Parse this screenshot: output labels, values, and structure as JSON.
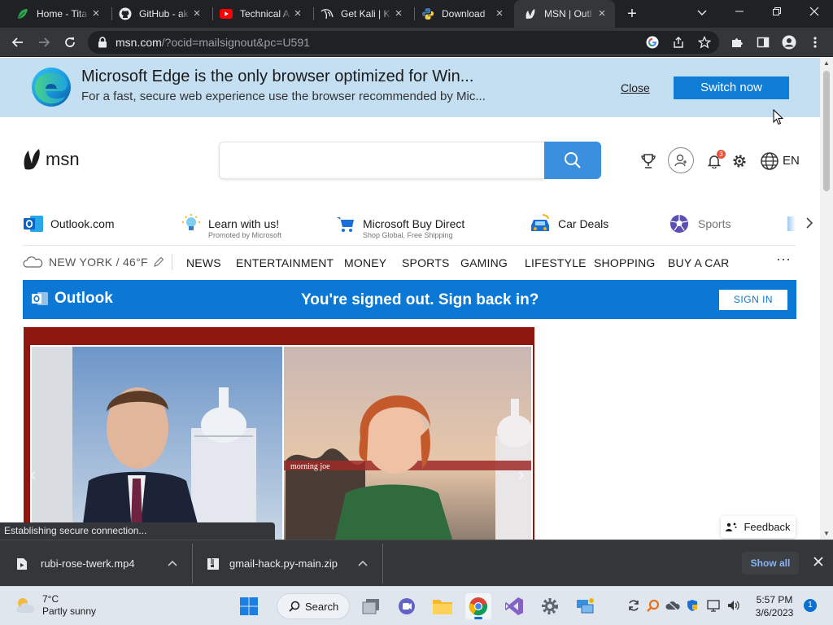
{
  "browser": {
    "tabs": [
      {
        "title": "Home - Tita",
        "favicon": "leaf-icon"
      },
      {
        "title": "GitHub - ak",
        "favicon": "github-icon"
      },
      {
        "title": "Technical A",
        "favicon": "youtube-icon"
      },
      {
        "title": "Get Kali | K",
        "favicon": "kali-dragon-icon"
      },
      {
        "title": "Download",
        "favicon": "python-icon"
      },
      {
        "title": "MSN | Outl",
        "favicon": "msn-butterfly-icon",
        "active": true
      }
    ],
    "url_host": "msn.com",
    "url_rest": "/?ocid=mailsignout&pc=U591"
  },
  "edge_banner": {
    "title": "Microsoft Edge is the only browser optimized for Win...",
    "subtitle": "For a fast, secure web experience use the browser recommended by Mic...",
    "close_label": "Close",
    "switch_label": "Switch now"
  },
  "msn": {
    "logo_text": "msn",
    "search_placeholder": "",
    "notification_count": "3",
    "language": "EN"
  },
  "quick_links": [
    {
      "label": "Outlook.com",
      "sub": ""
    },
    {
      "label": "Learn with us!",
      "sub": "Promoted by Microsoft"
    },
    {
      "label": "Microsoft Buy Direct",
      "sub": "Shop Global, Free Shipping"
    },
    {
      "label": "Car Deals",
      "sub": ""
    },
    {
      "label": "Sports",
      "sub": ""
    }
  ],
  "nav": {
    "weather": "NEW YORK / 46°F",
    "items": [
      "NEWS",
      "ENTERTAINMENT",
      "MONEY",
      "SPORTS",
      "GAMING",
      "LIFESTYLE",
      "SHOPPING",
      "BUY A CAR"
    ],
    "more": "···"
  },
  "outlook_banner": {
    "brand": "Outlook",
    "message": "You're signed out. Sign back in?",
    "signin_label": "SIGN IN"
  },
  "hero": {
    "caption_text": "morning joe"
  },
  "feedback_label": "Feedback",
  "status_text": "Establishing secure connection...",
  "downloads": {
    "items": [
      {
        "name": "rubi-rose-twerk.mp4"
      },
      {
        "name": "gmail-hack.py-main.zip"
      }
    ],
    "show_all": "Show all"
  },
  "taskbar": {
    "weather_temp": "7°C",
    "weather_cond": "Partly sunny",
    "search_label": "Search",
    "time": "5:57 PM",
    "date": "3/6/2023",
    "notification_count": "1"
  },
  "colors": {
    "chrome_dark": "#202124",
    "chrome_toolbar": "#35363a",
    "edge_banner_bg": "#c4dff1",
    "switch_btn": "#0f7dd6",
    "msn_search_btn": "#3a8fde",
    "outlook_blue": "#0a78d4"
  }
}
